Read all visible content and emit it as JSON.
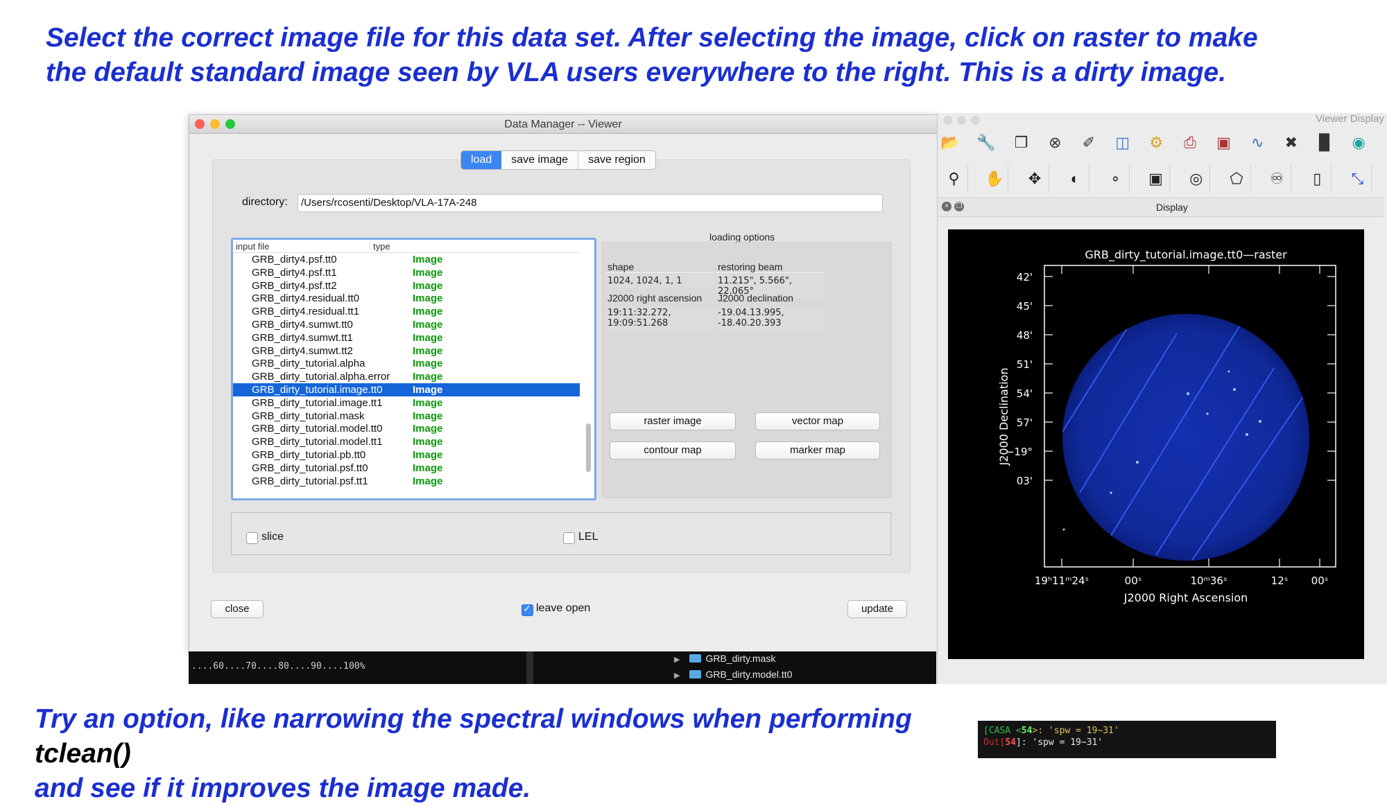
{
  "captions": {
    "top_line1": "Select the correct image file for this data set. After selecting the image, click on raster to make",
    "top_line2": "the default standard image seen by VLA users everywhere to the right. This is a dirty image.",
    "bottom_part1": "Try an option, like narrowing the spectral windows when performing ",
    "bottom_code": "tclean()",
    "bottom_line2": "and see if it improves the image made."
  },
  "data_manager": {
    "title": "Data Manager -- Viewer",
    "tabs": [
      "load",
      "save image",
      "save region"
    ],
    "directory_label": "directory:",
    "directory_value": "/Users/rcosenti/Desktop/VLA-17A-248",
    "file_list": {
      "col_input_file": "input file",
      "col_type": "type",
      "files": [
        {
          "name": "GRB_dirty4.psf.tt0",
          "type": "Image"
        },
        {
          "name": "GRB_dirty4.psf.tt1",
          "type": "Image"
        },
        {
          "name": "GRB_dirty4.psf.tt2",
          "type": "Image"
        },
        {
          "name": "GRB_dirty4.residual.tt0",
          "type": "Image"
        },
        {
          "name": "GRB_dirty4.residual.tt1",
          "type": "Image"
        },
        {
          "name": "GRB_dirty4.sumwt.tt0",
          "type": "Image"
        },
        {
          "name": "GRB_dirty4.sumwt.tt1",
          "type": "Image"
        },
        {
          "name": "GRB_dirty4.sumwt.tt2",
          "type": "Image"
        },
        {
          "name": "GRB_dirty_tutorial.alpha",
          "type": "Image"
        },
        {
          "name": "GRB_dirty_tutorial.alpha.error",
          "type": "Image"
        },
        {
          "name": "GRB_dirty_tutorial.image.tt0",
          "type": "Image",
          "selected": true
        },
        {
          "name": "GRB_dirty_tutorial.image.tt1",
          "type": "Image"
        },
        {
          "name": "GRB_dirty_tutorial.mask",
          "type": "Image"
        },
        {
          "name": "GRB_dirty_tutorial.model.tt0",
          "type": "Image"
        },
        {
          "name": "GRB_dirty_tutorial.model.tt1",
          "type": "Image"
        },
        {
          "name": "GRB_dirty_tutorial.pb.tt0",
          "type": "Image"
        },
        {
          "name": "GRB_dirty_tutorial.psf.tt0",
          "type": "Image"
        },
        {
          "name": "GRB_dirty_tutorial.psf.tt1",
          "type": "Image"
        }
      ]
    },
    "loading_options": {
      "title": "loading options",
      "shape_label": "shape",
      "shape_value": "1024, 1024, 1, 1",
      "beam_label": "restoring beam",
      "beam_value": "11.215\", 5.566\", 22.065°",
      "ra_label": "J2000 right ascension",
      "ra_value": "19:11:32.272, 19:09:51.268",
      "dec_label": "J2000 declination",
      "dec_value": "-19.04.13.995, -18.40.20.393",
      "buttons": [
        "raster image",
        "vector map",
        "contour map",
        "marker map"
      ]
    },
    "slice_label": "slice",
    "lel_label": "LEL",
    "close_label": "close",
    "leave_open_label": "leave open",
    "leave_open_checked": true,
    "update_label": "update"
  },
  "terminal": {
    "progress": "....60....70....80....90....100%",
    "folders": [
      "GRB_dirty.mask",
      "GRB_dirty.model.tt0"
    ]
  },
  "viewer": {
    "title": "Viewer Display",
    "dock_title": "Display",
    "plot_title": "GRB_dirty_tutorial.image.tt0—raster",
    "ylabel": "J2000 Declination",
    "xlabel": "J2000 Right Ascension",
    "dec_ticks": [
      "42'",
      "45'",
      "48'",
      "51'",
      "54'",
      "57'",
      "−19°",
      "03'"
    ],
    "ra_ticks": [
      "19ʰ11ᵐ24ˢ",
      "00ˢ",
      "10ᵐ36ˢ",
      "12ˢ",
      "00ˢ"
    ],
    "toolbar1_icons": [
      "open-folder-icon",
      "wrench-icon",
      "copy-icon",
      "close-circle-icon",
      "brush-icon",
      "new-panel-icon",
      "preferences-icon",
      "print-icon",
      "save-image-icon",
      "profile-icon",
      "shuffle-icon",
      "histogram-icon",
      "fit-icon",
      "scripting-icon"
    ],
    "toolbar2_icons": [
      "zoom-icon",
      "pan-hand-icon",
      "move-cross-icon",
      "color-stretch-icon",
      "point-icon",
      "rectangle-region-icon",
      "ellipse-region-icon",
      "polygon-region-icon",
      "polyline-icon",
      "ruler-icon",
      "distance-icon"
    ],
    "colors": {
      "image_blue": "#1a2fd0",
      "disk": "#102a9a"
    }
  },
  "casa_prompt": {
    "line1_prefix": "[CASA <",
    "line1_num": "54",
    "line1_suffix": ">: 'spw = 19~31'",
    "line2_prefix": "Out[",
    "line2_num": "54",
    "line2_suffix": "]: 'spw = 19~31'"
  }
}
